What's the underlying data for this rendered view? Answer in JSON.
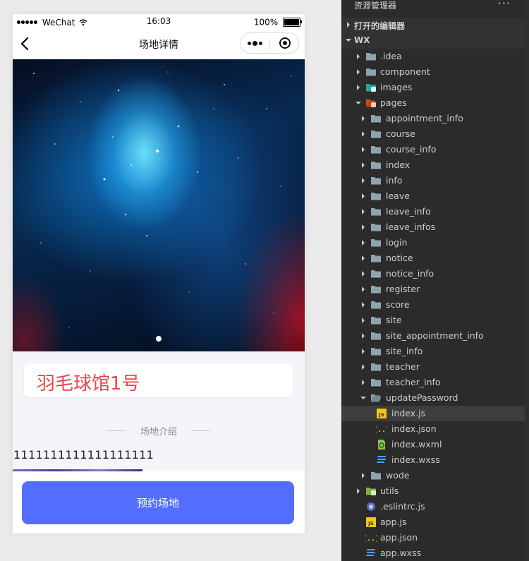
{
  "status_bar": {
    "carrier": "WeChat",
    "time": "16:03",
    "battery": "100%"
  },
  "nav": {
    "title": "场地详情"
  },
  "venue": {
    "name": "羽毛球馆1号",
    "section_title": "场地介绍",
    "description": "1111111111111111111",
    "book_label": "预约场地"
  },
  "explorer": {
    "header": "资源管理器",
    "sections": {
      "open_editors": "打开的编辑器",
      "project": "WX"
    },
    "tree": [
      {
        "label": ".idea",
        "icon": "folder",
        "depth": 1,
        "expand": "collapsed"
      },
      {
        "label": "component",
        "icon": "folder",
        "depth": 1,
        "expand": "collapsed"
      },
      {
        "label": "images",
        "icon": "folder-images",
        "depth": 1,
        "expand": "collapsed"
      },
      {
        "label": "pages",
        "icon": "folder-pages",
        "depth": 1,
        "expand": "expanded"
      },
      {
        "label": "appointment_info",
        "icon": "folder",
        "depth": 2,
        "expand": "collapsed"
      },
      {
        "label": "course",
        "icon": "folder",
        "depth": 2,
        "expand": "collapsed"
      },
      {
        "label": "course_info",
        "icon": "folder",
        "depth": 2,
        "expand": "collapsed"
      },
      {
        "label": "index",
        "icon": "folder",
        "depth": 2,
        "expand": "collapsed"
      },
      {
        "label": "info",
        "icon": "folder",
        "depth": 2,
        "expand": "collapsed"
      },
      {
        "label": "leave",
        "icon": "folder",
        "depth": 2,
        "expand": "collapsed"
      },
      {
        "label": "leave_info",
        "icon": "folder",
        "depth": 2,
        "expand": "collapsed"
      },
      {
        "label": "leave_infos",
        "icon": "folder",
        "depth": 2,
        "expand": "collapsed"
      },
      {
        "label": "login",
        "icon": "folder",
        "depth": 2,
        "expand": "collapsed"
      },
      {
        "label": "notice",
        "icon": "folder",
        "depth": 2,
        "expand": "collapsed"
      },
      {
        "label": "notice_info",
        "icon": "folder",
        "depth": 2,
        "expand": "collapsed"
      },
      {
        "label": "register",
        "icon": "folder",
        "depth": 2,
        "expand": "collapsed"
      },
      {
        "label": "score",
        "icon": "folder",
        "depth": 2,
        "expand": "collapsed"
      },
      {
        "label": "site",
        "icon": "folder",
        "depth": 2,
        "expand": "collapsed"
      },
      {
        "label": "site_appointment_info",
        "icon": "folder",
        "depth": 2,
        "expand": "collapsed"
      },
      {
        "label": "site_info",
        "icon": "folder",
        "depth": 2,
        "expand": "collapsed"
      },
      {
        "label": "teacher",
        "icon": "folder",
        "depth": 2,
        "expand": "collapsed"
      },
      {
        "label": "teacher_info",
        "icon": "folder",
        "depth": 2,
        "expand": "collapsed"
      },
      {
        "label": "updatePassword",
        "icon": "folder-open",
        "depth": 2,
        "expand": "expanded"
      },
      {
        "label": "index.js",
        "icon": "js",
        "depth": 3,
        "expand": "none",
        "selected": true
      },
      {
        "label": "index.json",
        "icon": "json",
        "depth": 3,
        "expand": "none"
      },
      {
        "label": "index.wxml",
        "icon": "wxml",
        "depth": 3,
        "expand": "none"
      },
      {
        "label": "index.wxss",
        "icon": "wxss",
        "depth": 3,
        "expand": "none"
      },
      {
        "label": "wode",
        "icon": "folder",
        "depth": 2,
        "expand": "collapsed"
      },
      {
        "label": "utils",
        "icon": "folder-utils",
        "depth": 1,
        "expand": "collapsed"
      },
      {
        "label": ".eslintrc.js",
        "icon": "eslint",
        "depth": 1,
        "expand": "none"
      },
      {
        "label": "app.js",
        "icon": "js",
        "depth": 1,
        "expand": "none"
      },
      {
        "label": "app.json",
        "icon": "json",
        "depth": 1,
        "expand": "none"
      },
      {
        "label": "app.wxss",
        "icon": "wxss",
        "depth": 1,
        "expand": "none"
      }
    ]
  },
  "colors": {
    "accent_button": "#536efe",
    "venue_name": "#e5484d",
    "selected_row": "#3d3d3d",
    "folder": "#90a4ae",
    "js": "#f5c518",
    "wxml": "#8bc34a",
    "wxss": "#42a5f5",
    "folder_pages": "#e64a19",
    "folder_images": "#26a69a",
    "folder_utils": "#7cb342",
    "eslint": "#5c6bc0"
  }
}
